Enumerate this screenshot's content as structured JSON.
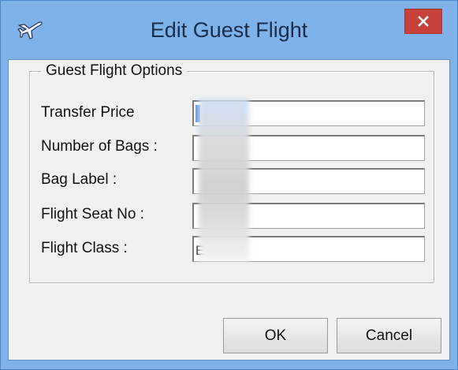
{
  "window": {
    "title": "Edit Guest Flight",
    "icon": "airplane-icon",
    "close_icon": "close-icon"
  },
  "group": {
    "legend": "Guest Flight Options"
  },
  "fields": [
    {
      "label": "Transfer Price",
      "value": ""
    },
    {
      "label": "Number of Bags :",
      "value": ""
    },
    {
      "label": "Bag Label :",
      "value": ""
    },
    {
      "label": "Flight Seat No :",
      "value": ""
    },
    {
      "label": "Flight Class :",
      "value": "E"
    }
  ],
  "buttons": {
    "ok": "OK",
    "cancel": "Cancel"
  },
  "colors": {
    "title_bar": "#7fb2e8",
    "close_button": "#c7403a",
    "client_bg": "#f0f0f0"
  }
}
